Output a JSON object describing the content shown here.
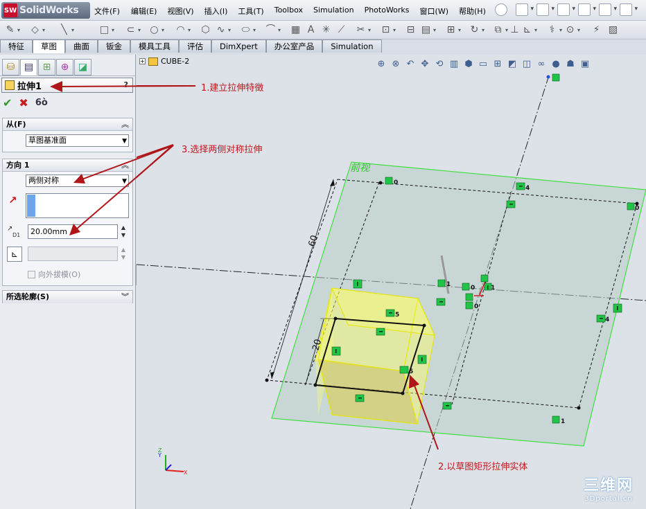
{
  "app": {
    "logo_text": "SolidWorks",
    "logo_mark": "SW"
  },
  "menu": [
    "文件(F)",
    "编辑(E)",
    "视图(V)",
    "插入(I)",
    "工具(T)",
    "Toolbox",
    "Simulation",
    "PhotoWorks",
    "窗口(W)",
    "帮助(H)"
  ],
  "command_tabs": [
    "特征",
    "草图",
    "曲面",
    "钣金",
    "模具工具",
    "评估",
    "DimXpert",
    "办公室产品",
    "Simulation"
  ],
  "active_command_tab": "草图",
  "property_manager": {
    "title": "拉伸1",
    "help": "?",
    "from_group": {
      "header": "从(F)",
      "value": "草图基准面"
    },
    "direction_group": {
      "header": "方向 1",
      "end_condition": "两侧对称",
      "depth": "20.00mm",
      "draft_outward_label": "向外拔模(O)"
    },
    "contours_group": {
      "header": "所选轮廓(S)"
    }
  },
  "tree": {
    "root": "CUBE-2"
  },
  "viewport": {
    "plane_label": "前视",
    "dim_horizontal": "60",
    "dim_vertical": "20",
    "relations": [
      "0",
      "4",
      "0",
      "1",
      "0",
      "1",
      "0",
      "4",
      "5",
      "5",
      "1"
    ],
    "triad": {
      "x": "X",
      "y": "Y",
      "z": "Z"
    }
  },
  "annotations": {
    "a1": "1.建立拉伸特徵",
    "a2": "2.以草图矩形拉伸实体",
    "a3": "3.选择两侧对称拉伸"
  },
  "watermark": {
    "big": "三维网",
    "small": "3Dportal.cn"
  },
  "colors": {
    "plane_edge": "#3fe03f",
    "preview_fill": "#ffff66",
    "relation_green": "#22c447",
    "annotation_red": "#c0171c",
    "sketch_line": "#000000"
  }
}
